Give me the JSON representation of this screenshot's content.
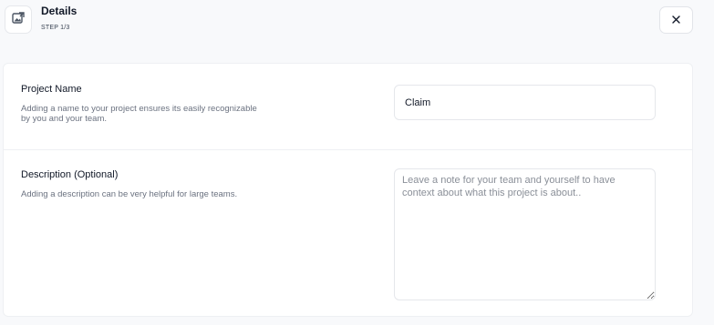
{
  "header": {
    "title": "Details",
    "step": "STEP 1/3",
    "icon": "swap-image-icon",
    "close_label": "×"
  },
  "form": {
    "project_name": {
      "title": "Project Name",
      "description": "Adding a name to your project ensures its easily recognizable by you and your team.",
      "value": "Claim"
    },
    "description": {
      "title": "Description (Optional)",
      "description": "Adding a description can be very helpful for large teams.",
      "placeholder": "Leave a note for your team and yourself to have context about what this project is about.."
    }
  },
  "colors": {
    "background": "#f8f9fb",
    "card": "#ffffff",
    "border": "#e5e7eb",
    "muted_text": "#6b7280"
  }
}
